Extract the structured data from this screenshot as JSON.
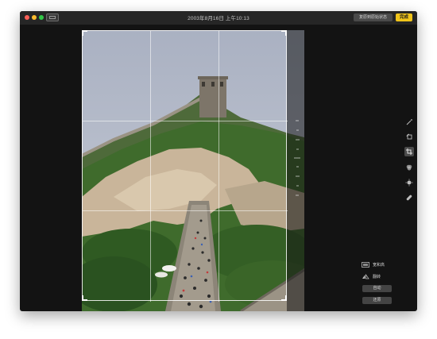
{
  "window": {
    "title": "2003年8月16日 上午10:13",
    "revert_label": "复原到原始状态",
    "done_label": "完成"
  },
  "toolbar_right": {
    "tools": [
      {
        "name": "magic-wand-icon"
      },
      {
        "name": "rotate-icon"
      },
      {
        "name": "crop-icon",
        "active": true
      },
      {
        "name": "filters-icon"
      },
      {
        "name": "adjust-icon"
      },
      {
        "name": "retouch-bandage-icon"
      }
    ]
  },
  "crop_panel": {
    "aspect_label": "宽和高",
    "flip_label": "翻转",
    "auto_label": "自动",
    "reset_label": "还原"
  },
  "colors": {
    "done_button": "#f0c41a",
    "window_bg": "#131313",
    "titlebar": "#262626"
  }
}
